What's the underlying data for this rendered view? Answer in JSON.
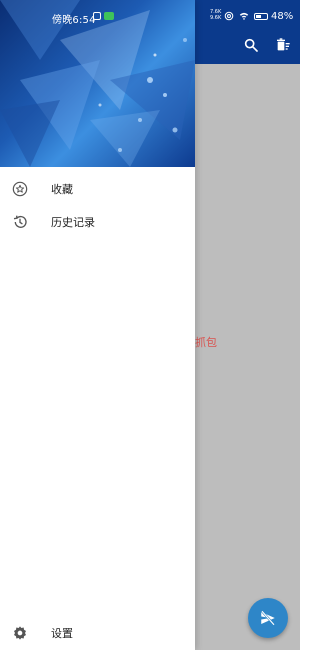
{
  "status_bar": {
    "time": "傍晚6:54",
    "net_speed_up": "7.6K",
    "net_speed_down": "9.6K",
    "battery_percent": "48%",
    "battery_level": 0.48
  },
  "toolbar": {
    "search_icon": "search-icon",
    "delete_icon": "delete-sweep-icon"
  },
  "main": {
    "center_text_fragment": "抓包"
  },
  "drawer": {
    "items": [
      {
        "label": "收藏",
        "icon": "star-circle-icon"
      },
      {
        "label": "历史记录",
        "icon": "history-icon"
      }
    ],
    "footer": {
      "label": "设置",
      "icon": "gear-icon"
    }
  },
  "fab": {
    "icon": "send-off-icon"
  },
  "colors": {
    "toolbar": "#0b3a8c",
    "scrim": "#bdbdbd",
    "fab": "#2e86c8"
  }
}
